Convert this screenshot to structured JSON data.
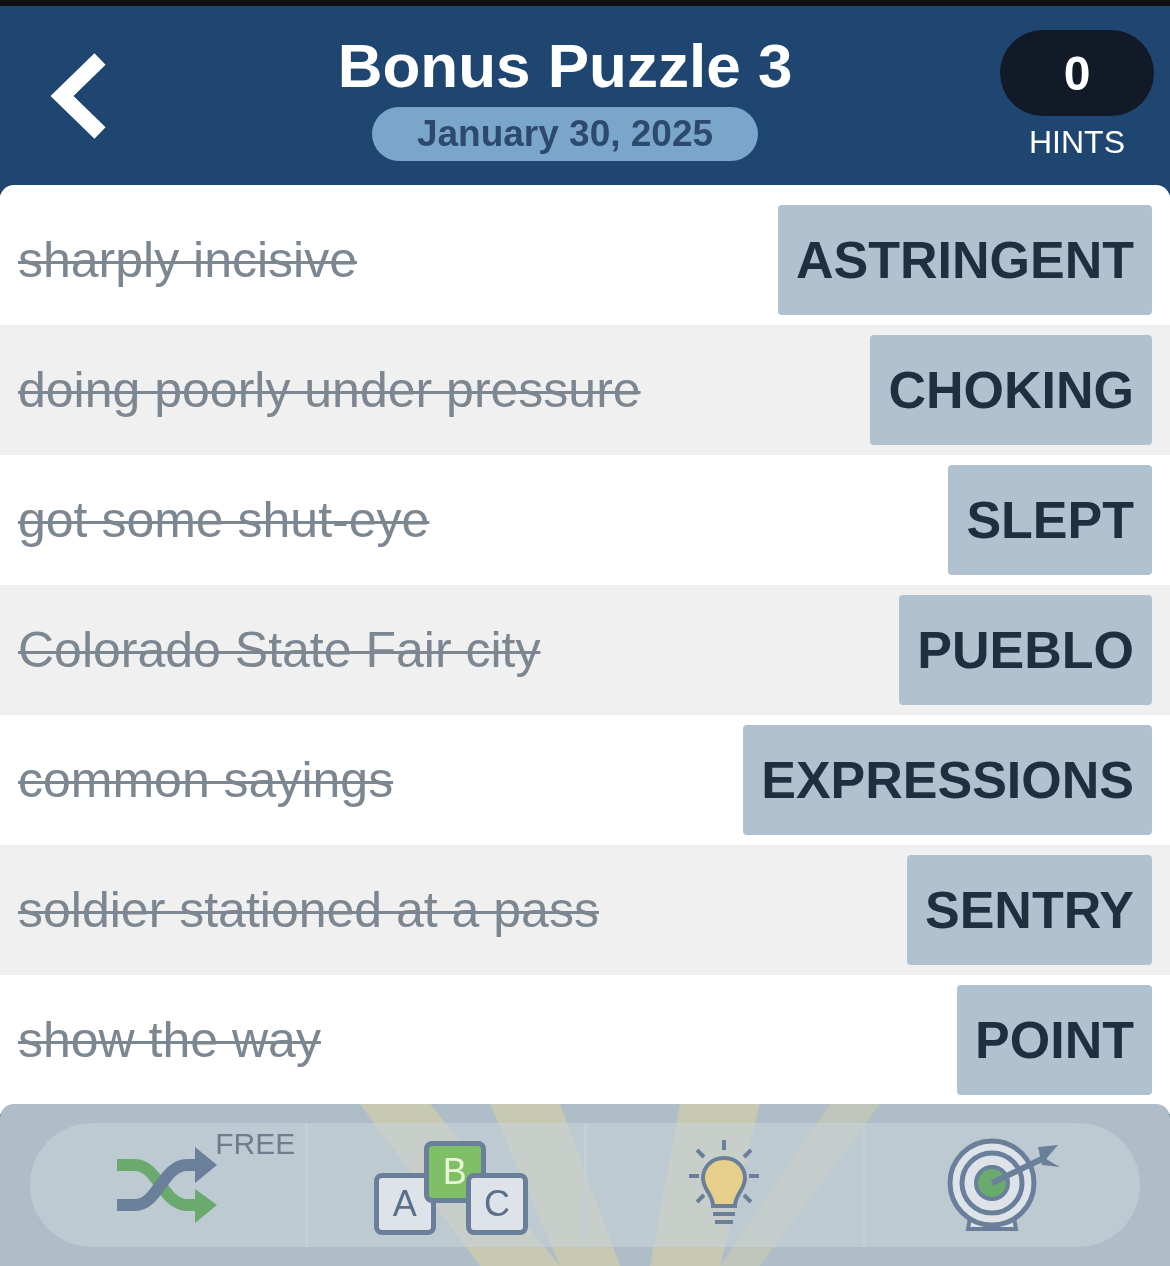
{
  "header": {
    "title": "Bonus Puzzle 3",
    "date": "January 30, 2025",
    "hints": {
      "count": "0",
      "label": "HINTS"
    }
  },
  "rows": [
    {
      "clue": "sharply incisive",
      "answer": "ASTRINGENT",
      "solved": true
    },
    {
      "clue": "doing poorly under pressure",
      "answer": "CHOKING",
      "solved": true
    },
    {
      "clue": "got some shut-eye",
      "answer": "SLEPT",
      "solved": true
    },
    {
      "clue": "Colorado State Fair city",
      "answer": "PUEBLO",
      "solved": true
    },
    {
      "clue": "common sayings",
      "answer": "EXPRESSIONS",
      "solved": true
    },
    {
      "clue": "soldier stationed at a pass",
      "answer": "SENTRY",
      "solved": true
    },
    {
      "clue": "show the way",
      "answer": "POINT",
      "solved": true
    }
  ],
  "toolbar": [
    {
      "kind": "shuffle",
      "badge": "FREE"
    },
    {
      "kind": "letters",
      "letters": [
        "A",
        "B",
        "C"
      ]
    },
    {
      "kind": "hint"
    },
    {
      "kind": "target"
    }
  ]
}
